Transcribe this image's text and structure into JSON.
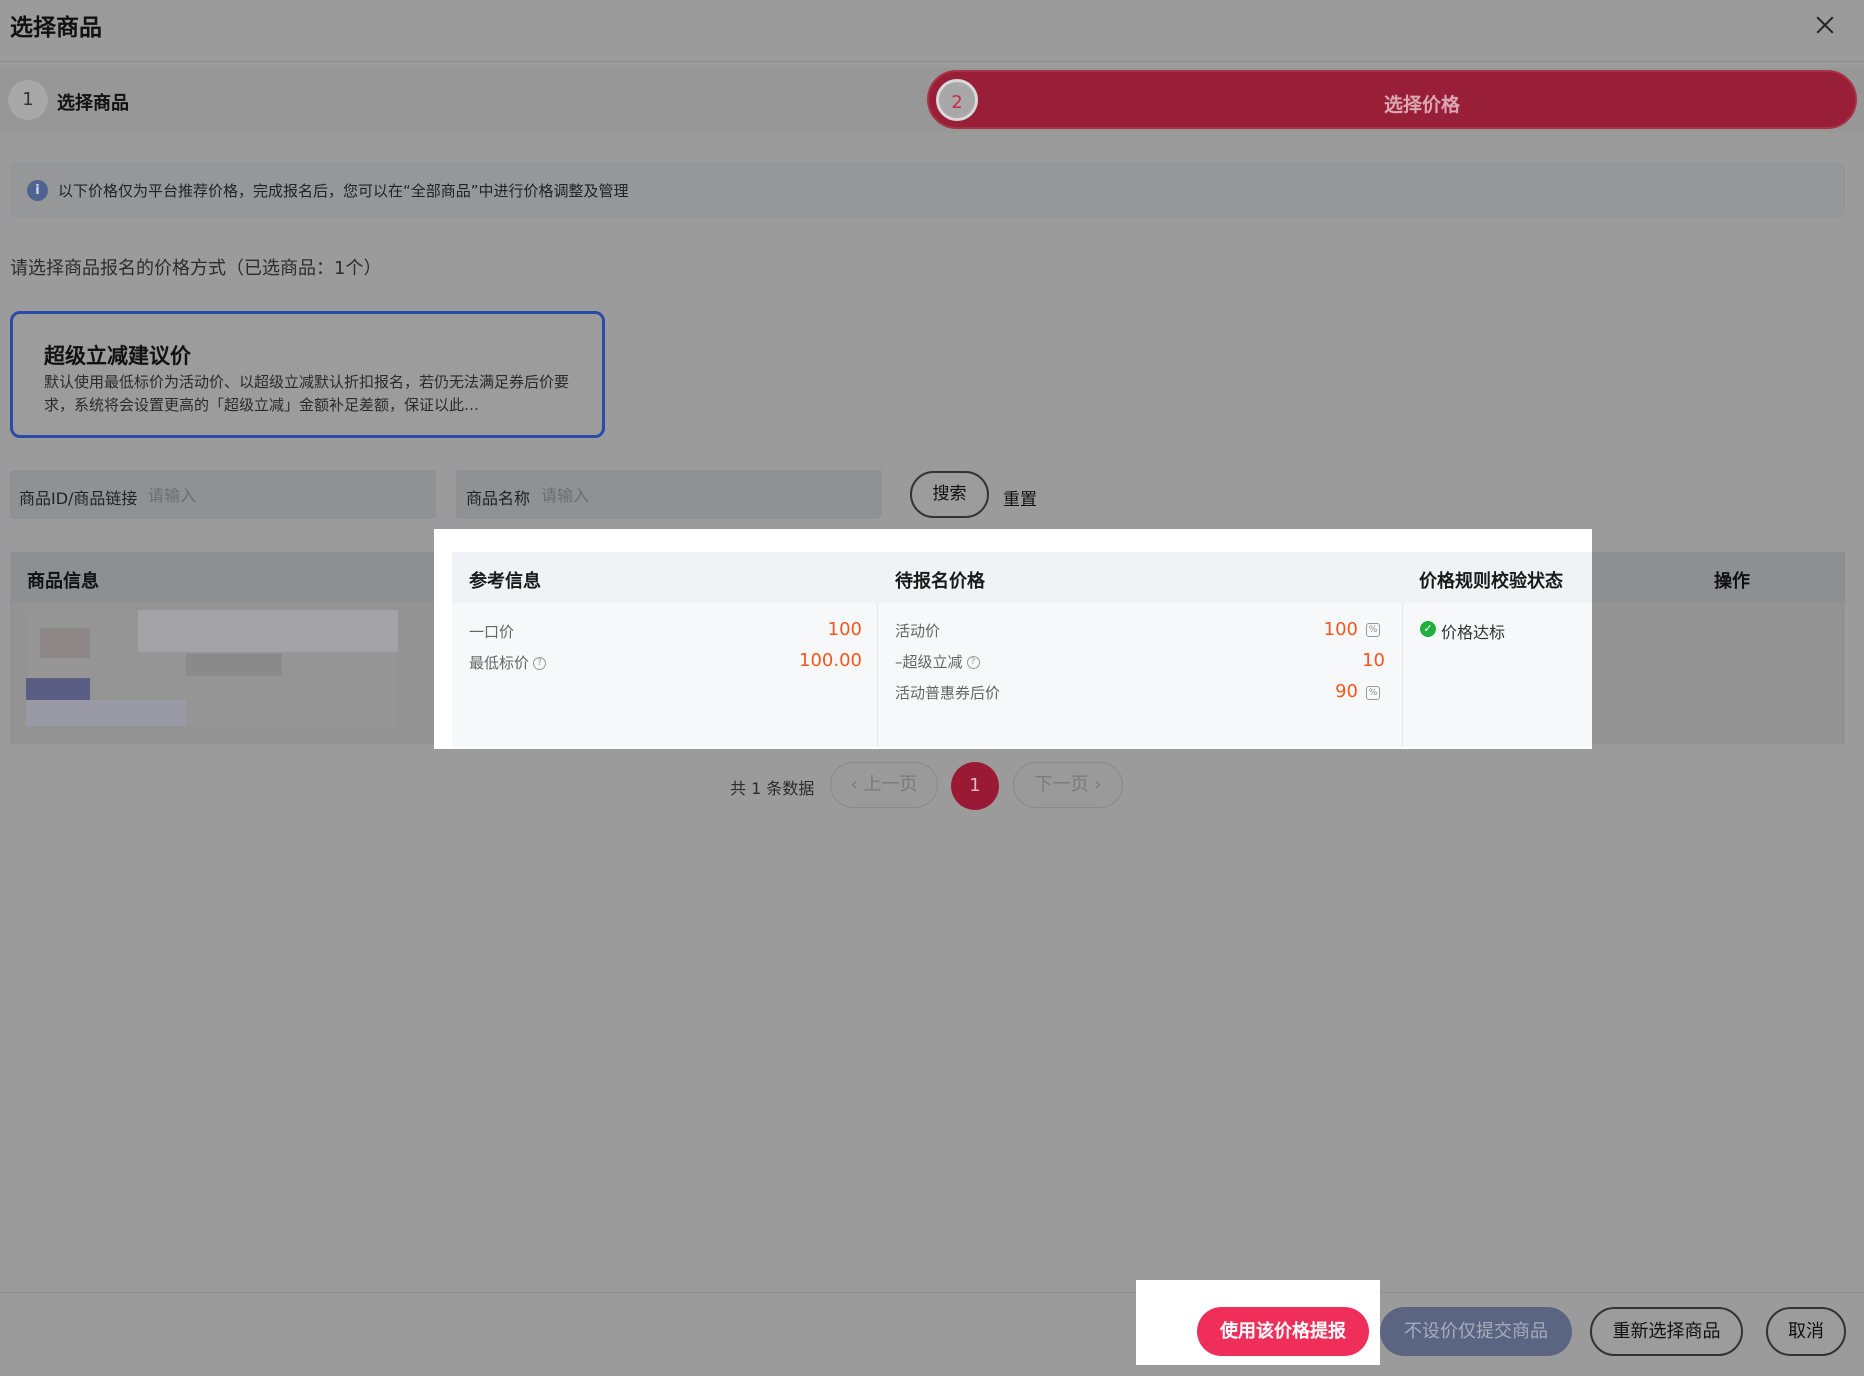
{
  "header": {
    "title": "选择商品"
  },
  "steps": [
    {
      "num": "1",
      "label": "选择商品"
    },
    {
      "num": "2",
      "label": "选择价格"
    }
  ],
  "info_banner": {
    "text": "以下价格仅为平台推荐价格，完成报名后，您可以在“全部商品”中进行价格调整及管理"
  },
  "subtitle": "请选择商品报名的价格方式（已选商品：1个）",
  "price_mode": {
    "title": "超级立减建议价",
    "desc": "默认使用最低标价为活动价、以超级立减默认折扣报名，若仍无法满足券后价要求，系统将会设置更高的「超级立减」金额补足差额，保证以此…"
  },
  "filters": {
    "product_id_label": "商品ID/商品链接",
    "product_id_placeholder": "请输入",
    "product_name_label": "商品名称",
    "product_name_placeholder": "请输入",
    "search_label": "搜索",
    "reset_label": "重置"
  },
  "table": {
    "headers": {
      "product_info": "商品信息",
      "reference": "参考信息",
      "pending_price": "待报名价格",
      "rule_status": "价格规则校验状态",
      "operation": "操作"
    },
    "row": {
      "reference": [
        {
          "label": "一口价",
          "value": "100",
          "help": false
        },
        {
          "label": "最低标价",
          "value": "100.00",
          "help": true
        }
      ],
      "pending": [
        {
          "label": "活动价",
          "value": "100",
          "editable": true,
          "help": false
        },
        {
          "label": "–超级立减",
          "value": "10",
          "editable": false,
          "help": true
        },
        {
          "label": "活动普惠券后价",
          "value": "90",
          "editable": true,
          "help": false
        }
      ],
      "status": "价格达标"
    }
  },
  "pagination": {
    "total": "共 1 条数据",
    "prev": "‹ 上一页",
    "current": "1",
    "next": "下一页 ›"
  },
  "footer": {
    "use_price": "使用该价格提报",
    "submit_no_price": "不设价仅提交商品",
    "reselect": "重新选择商品",
    "cancel": "取消"
  },
  "icons": {
    "info": "i",
    "help": "?",
    "edit": "%",
    "check": "✓"
  },
  "colors": {
    "accent": "#ef2f5a",
    "price_orange": "#f2571d",
    "status_green": "#20b040",
    "card_border": "#2c4aa8"
  }
}
